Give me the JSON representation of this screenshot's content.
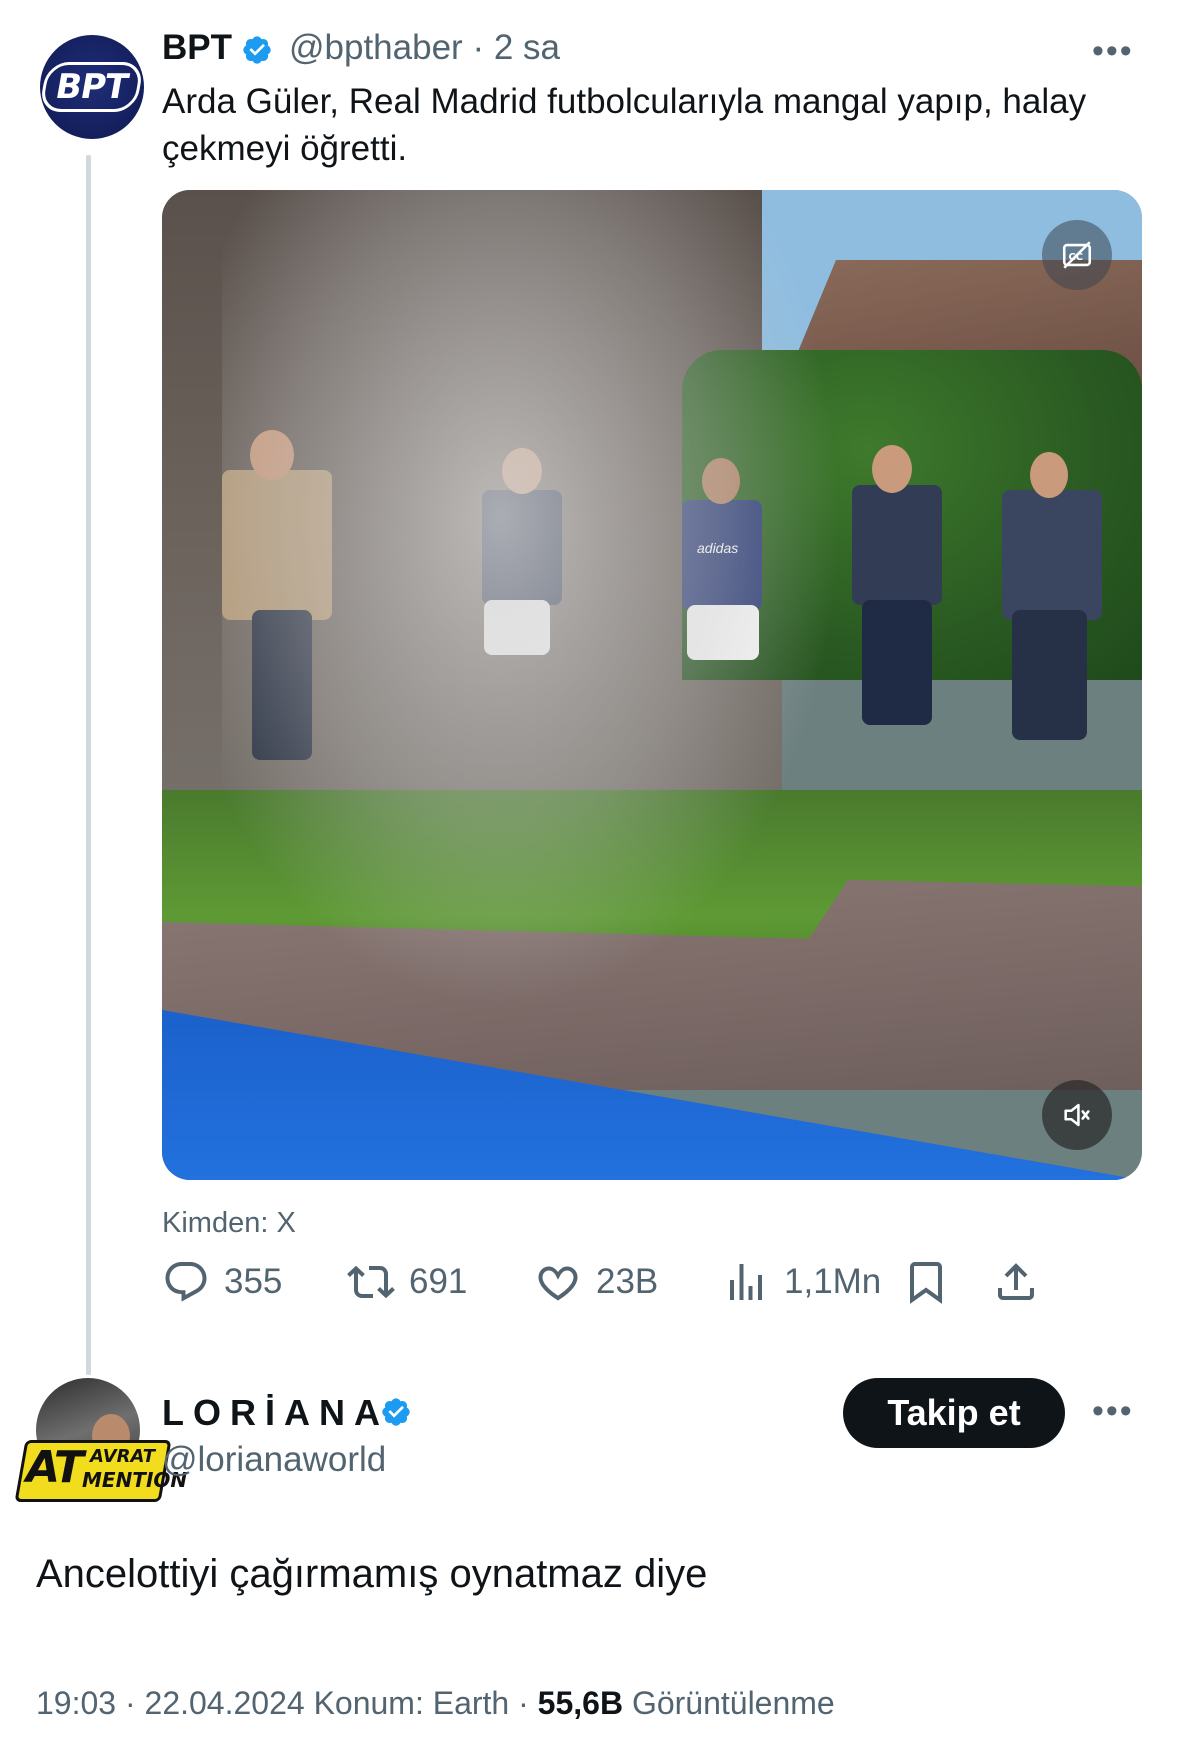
{
  "original_tweet": {
    "name": "BPT",
    "handle": "@bpthaber",
    "separator": "·",
    "time": "2 sa",
    "more": "•••",
    "avatar_logo": "BPT",
    "text": "Arda Güler, Real Madrid futbolcularıyla mangal yapıp, halay çekmeyi öğretti.",
    "media": {
      "type": "video",
      "jersey_text": "adidas",
      "icons": [
        "captions-off-icon",
        "volume-muted-icon"
      ]
    },
    "source": "Kimden: X",
    "actions": {
      "replies": "355",
      "reposts": "691",
      "likes": "23B",
      "views": "1,1Mn"
    }
  },
  "reply_tweet": {
    "name": "LORİANA",
    "handle": "@lorianaworld",
    "follow_label": "Takip et",
    "more": "•••",
    "avatar_sticker": {
      "big": "AT",
      "line1": "AVRAT",
      "line2": "MENTION"
    },
    "text": "Ancelottiyi çağırmamış oynatmaz diye",
    "meta_time": "19:03 · 22.04.2024 Konum: Earth · ",
    "meta_views": "55,6B",
    "meta_views_label": " Görüntülenme"
  },
  "colors": {
    "verified_blue": "#1d9bf0",
    "text_primary": "#0f1419",
    "text_secondary": "#536471",
    "thread_line": "#cfd9de",
    "sticker_yellow": "#f2dc1e"
  }
}
